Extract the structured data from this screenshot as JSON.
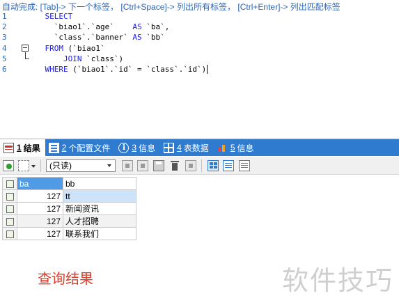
{
  "editor": {
    "hint": "自动完成: [Tab]-> 下一个标签， [Ctrl+Space]-> 列出所有标签， [Ctrl+Enter]-> 列出匹配标签",
    "lines": [
      {
        "no": "1",
        "segments": [
          {
            "t": "    "
          },
          {
            "t": "SELECT",
            "kw": true
          }
        ]
      },
      {
        "no": "2",
        "segments": [
          {
            "t": "      `biao1`.`age`    "
          },
          {
            "t": "AS",
            "kw": true
          },
          {
            "t": " `ba`,"
          }
        ]
      },
      {
        "no": "3",
        "segments": [
          {
            "t": "      `class`.`banner` "
          },
          {
            "t": "AS",
            "kw": true
          },
          {
            "t": " `bb`"
          }
        ]
      },
      {
        "no": "4",
        "segments": [
          {
            "t": "    "
          },
          {
            "t": "FROM",
            "kw": true
          },
          {
            "t": " (`biao1`"
          }
        ]
      },
      {
        "no": "5",
        "segments": [
          {
            "t": "        "
          },
          {
            "t": "JOIN",
            "kw": true
          },
          {
            "t": " `class`)"
          }
        ]
      },
      {
        "no": "6",
        "segments": [
          {
            "t": "    "
          },
          {
            "t": "WHERE",
            "kw": true
          },
          {
            "t": " (`biao1`.`id` = `class`.`id`)"
          }
        ]
      }
    ]
  },
  "tabs": [
    {
      "num": "1",
      "label": "结果",
      "icon": "result-icon",
      "active": true
    },
    {
      "num": "2",
      "label": "个配置文件",
      "icon": "config-icon",
      "active": false
    },
    {
      "num": "3",
      "label": "信息",
      "icon": "info-icon",
      "active": false
    },
    {
      "num": "4",
      "label": "表数据",
      "icon": "table-icon",
      "active": false
    },
    {
      "num": "5",
      "label": "信息",
      "icon": "info-chart-icon",
      "active": false
    }
  ],
  "toolbar": {
    "mode": "(只读)"
  },
  "grid": {
    "columns": [
      "ba",
      "bb"
    ],
    "rows": [
      {
        "ba": "127",
        "bb": "tt"
      },
      {
        "ba": "127",
        "bb": "新闻资讯"
      },
      {
        "ba": "127",
        "bb": "人才招聘"
      },
      {
        "ba": "127",
        "bb": "联系我们"
      }
    ]
  },
  "caption": "查询结果",
  "watermark": "软件技巧",
  "colors": {
    "tab_bar": "#2f7bd0",
    "keyword": "#2121e0",
    "caption": "#e03c28",
    "header_selected": "#4f9be6"
  }
}
